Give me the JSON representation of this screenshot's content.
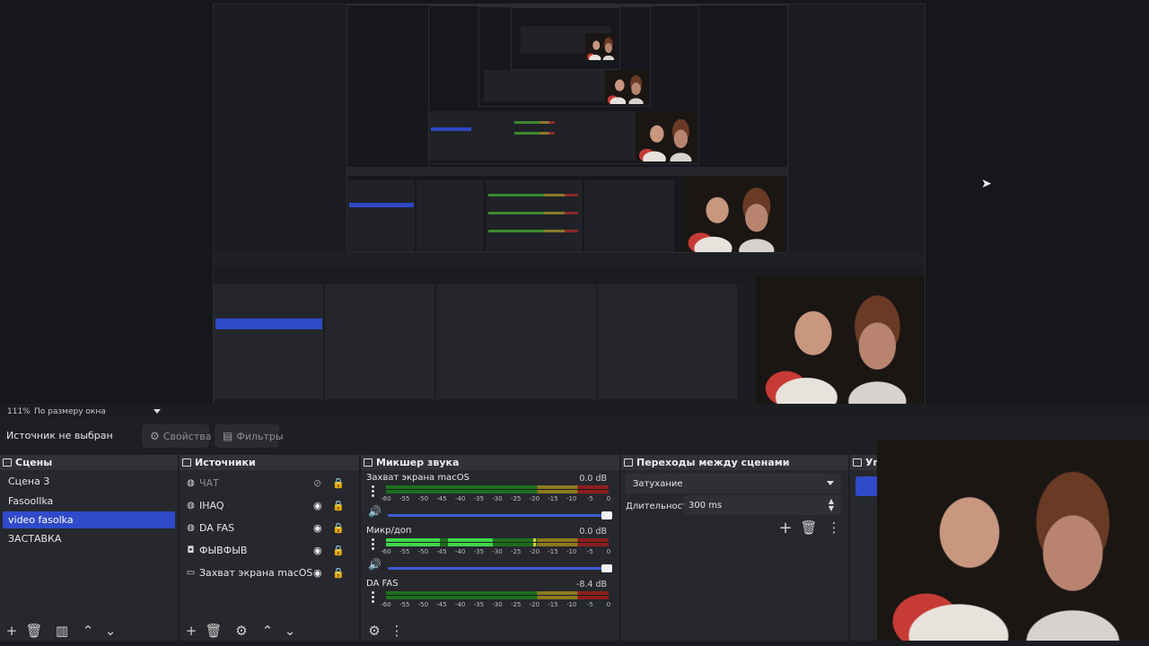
{
  "preview": {
    "inner_zoom": "111%",
    "inner_zoom_mode": "По размеру окна",
    "inner_no_source": "Источник не выбран",
    "inner_properties": "Свойства",
    "inner_filters": "Фильтры",
    "inner_scenes_title": "Сцены",
    "inner_scenes": [
      "Сцена 3",
      "Fasoollka",
      "video fasolka",
      "ЗАСТАВКА"
    ],
    "inner_sources_title": "Источники",
    "inner_sources": [
      "ЧАТ",
      "IHAQ",
      "DA FAS",
      "ФЫВФЫВ",
      "Захват экрана macOS"
    ],
    "inner_mixer_title": "Микшер звука",
    "inner_mixer": [
      {
        "name": "Захват экрана macOS",
        "db": "0.0 dB"
      },
      {
        "name": "Микр/доп",
        "db": "0.0 dB"
      },
      {
        "name": "DA FAS",
        "db": "-8.4 dB"
      }
    ],
    "inner_transitions_title": "Переходы между сценами",
    "inner_transition": "Затухание",
    "inner_duration_label": "Длительность",
    "inner_duration": "300 ms",
    "inner_controls_title": "Упр"
  },
  "zoombar": {
    "zoom": "111%",
    "mode": "По размеру окна"
  },
  "toolbar": {
    "no_source": "Источник не выбран",
    "properties": "Свойства",
    "filters": "Фильтры"
  },
  "scenes": {
    "title": "Сцены",
    "items": [
      "Сцена 3",
      "Fasoollka",
      "video fasolka",
      "ЗАСТАВКА"
    ],
    "active_index": 2
  },
  "sources": {
    "title": "Источники",
    "items": [
      {
        "label": "ЧАТ",
        "icon": "globe-icon",
        "visible": false
      },
      {
        "label": "IHAQ",
        "icon": "globe-icon",
        "visible": true
      },
      {
        "label": "DA FAS",
        "icon": "globe-icon",
        "visible": true
      },
      {
        "label": "ФЫВФЫВ",
        "icon": "camera-icon",
        "visible": true
      },
      {
        "label": "Захват экрана macOS",
        "icon": "monitor-icon",
        "visible": true
      }
    ]
  },
  "mixer": {
    "title": "Микшер звука",
    "channels": [
      {
        "name": "Захват экрана macOS",
        "db": "0.0 dB",
        "level": 0
      },
      {
        "name": "Микр/доп",
        "db": "0.0 dB",
        "level": 0.75
      },
      {
        "name": "DA FAS",
        "db": "-8.4 dB",
        "level": 0
      }
    ],
    "ticks": [
      "-60",
      "-55",
      "-50",
      "-45",
      "-40",
      "-35",
      "-30",
      "-25",
      "-20",
      "-15",
      "-10",
      "-5",
      "0"
    ]
  },
  "transitions": {
    "title": "Переходы между сценами",
    "selected": "Затухание",
    "duration_label": "Длительность",
    "duration": "300 ms"
  },
  "controls": {
    "title": "Упр"
  },
  "colors": {
    "accent": "#2f4bc9",
    "panel": "#26282d",
    "header": "#303237"
  }
}
